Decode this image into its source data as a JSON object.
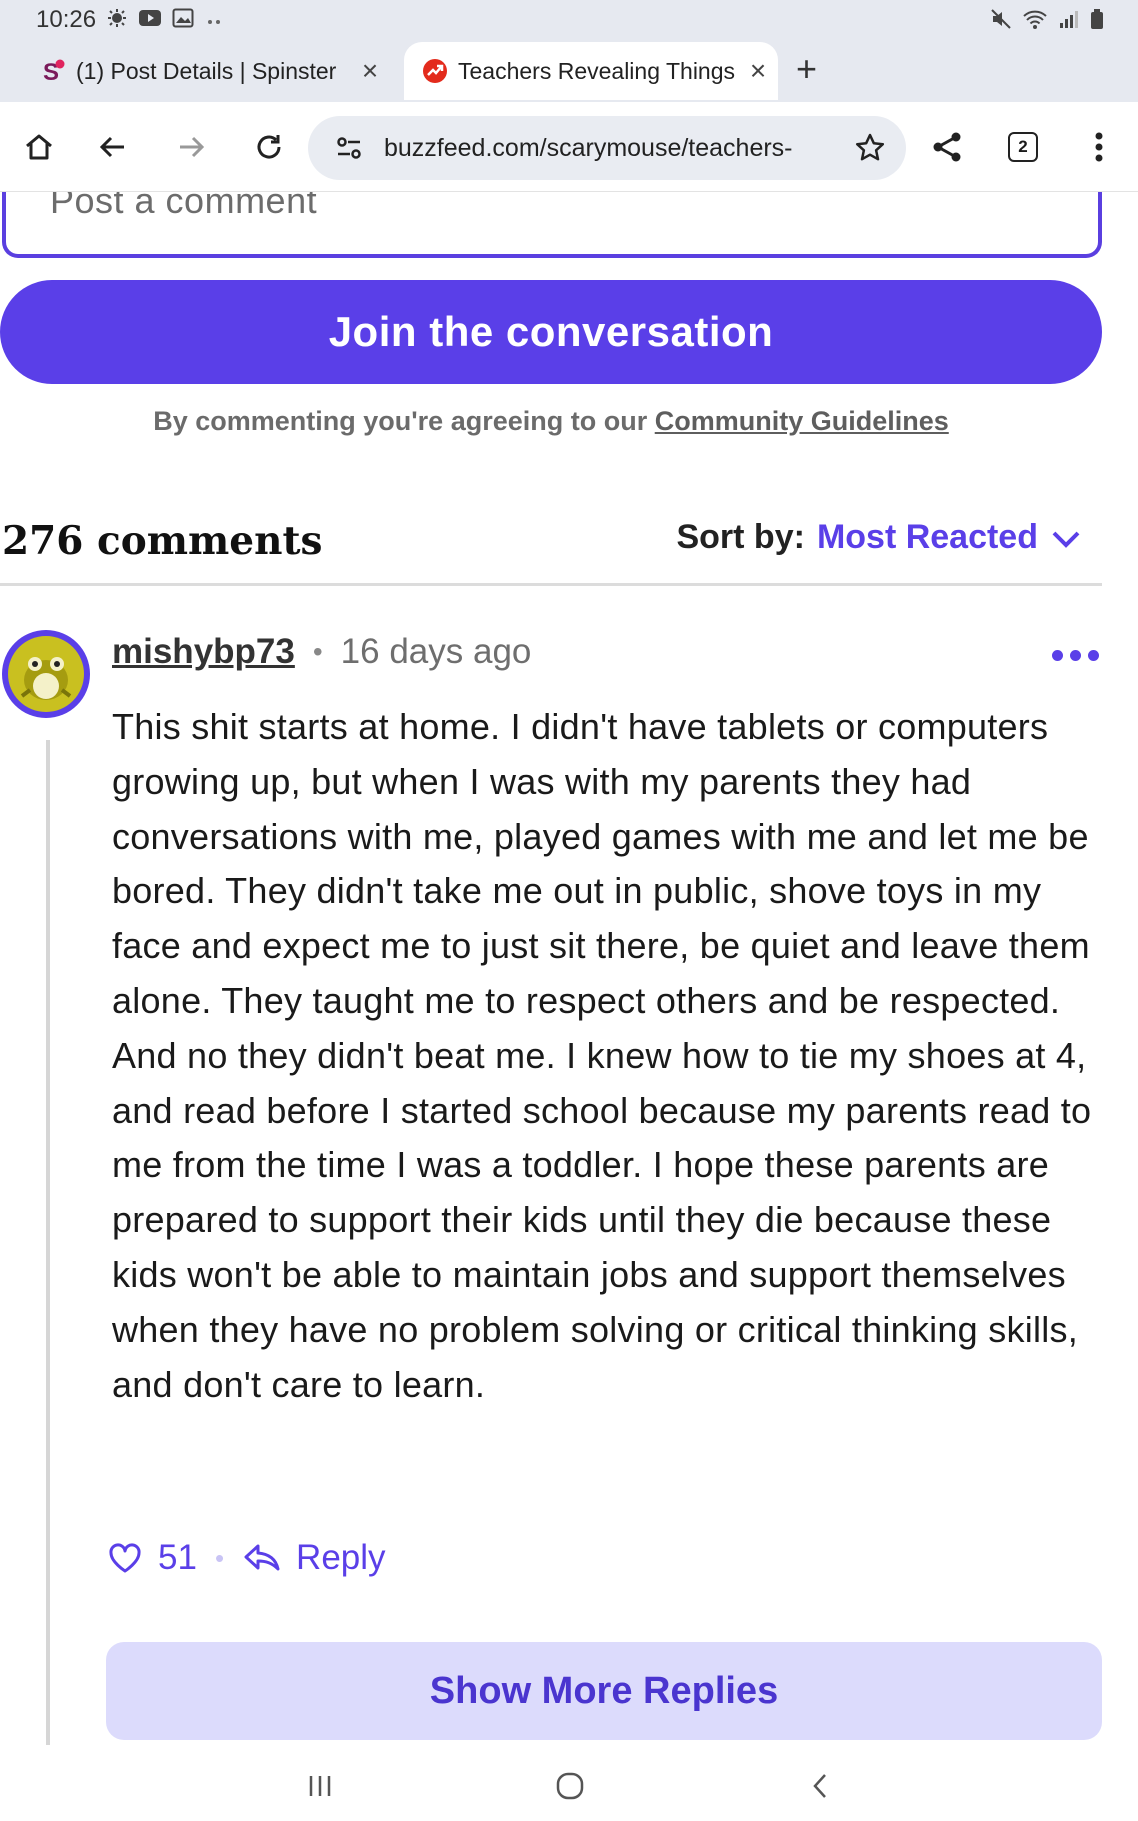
{
  "status_bar": {
    "time": "10:26"
  },
  "tabs": [
    {
      "title": "(1) Post Details | Spinster",
      "close": "×",
      "active": false
    },
    {
      "title": "Teachers Revealing Things S",
      "close": "×",
      "active": true
    }
  ],
  "new_tab_label": "+",
  "address_bar": {
    "url": "buzzfeed.com/scarymouse/teachers-",
    "tab_count": "2"
  },
  "comment_input": {
    "placeholder": "Post a comment"
  },
  "join_button": "Join the conversation",
  "agreement": {
    "prefix": "By commenting you're agreeing to our ",
    "link": "Community Guidelines"
  },
  "comments_header": {
    "count": "276 comments",
    "sort_label": "Sort by:",
    "sort_value": "Most Reacted"
  },
  "comment": {
    "username": "mishybp73",
    "separator": "•",
    "time": "16 days ago",
    "text": "This shit starts at home. I didn't have tablets or computers growing up, but when I was with my parents they had conversations with me, played games with me and let me be bored. They didn't take me out in public, shove toys in my face and expect me to just sit there, be quiet and leave them alone. They taught me to respect others and be respected. And no they didn't beat me. I knew how to tie my shoes at 4, and read before I started school because my parents read to me from the time I was a toddler. I hope these parents are prepared to support their kids until they die because these kids won't be able to maintain jobs and support themselves when they have no problem solving or critical thinking skills, and don't care to learn.",
    "likes": "51",
    "reply_label": "Reply"
  },
  "show_more_replies": "Show More Replies",
  "colors": {
    "accent": "#5a3fe8",
    "show_more_bg": "#dcdbfc"
  }
}
